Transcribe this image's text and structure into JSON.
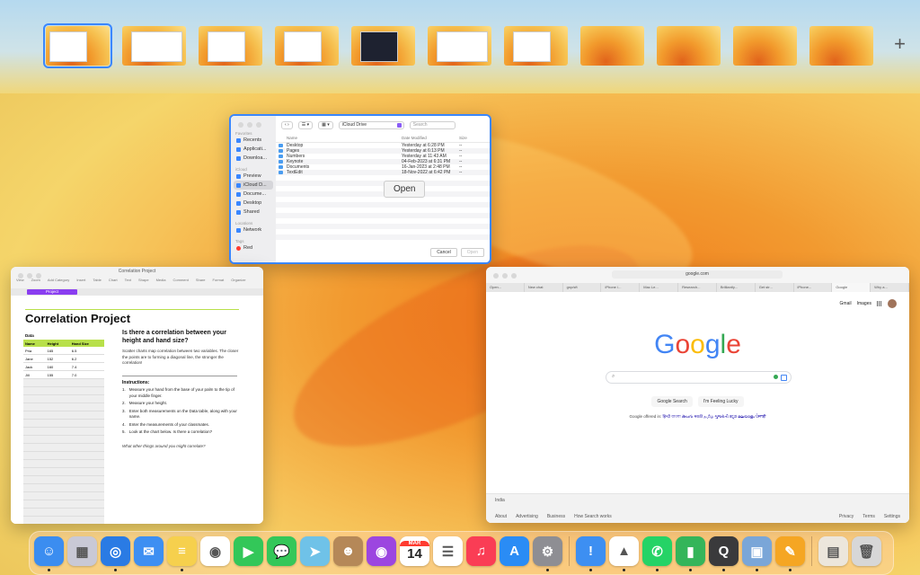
{
  "spaces": {
    "add_label": "+",
    "count": 11
  },
  "finder": {
    "sidebar": {
      "favorites_label": "Favorites",
      "favorites": [
        "Recents",
        "Applicati...",
        "Downloa..."
      ],
      "icloud_label": "iCloud",
      "icloud": [
        "Preview",
        "iCloud D...",
        "Docume...",
        "Desktop",
        "Shared"
      ],
      "locations_label": "Locations",
      "locations": [
        "Network"
      ],
      "tags_label": "Tags",
      "tags": [
        "Red"
      ]
    },
    "location": "iCloud Drive",
    "search_placeholder": "Search",
    "columns": {
      "name": "Name",
      "date": "Date Modified",
      "size": "Size"
    },
    "rows": [
      {
        "name": "Desktop",
        "date": "Yesterday at 6:28 PM",
        "size": "--"
      },
      {
        "name": "Pages",
        "date": "Yesterday at 6:13 PM",
        "size": "--"
      },
      {
        "name": "Numbers",
        "date": "Yesterday at 11:43 AM",
        "size": "--"
      },
      {
        "name": "Keynote",
        "date": "04-Feb-2023 at 6:31 PM",
        "size": "--"
      },
      {
        "name": "Documents",
        "date": "16-Jan-2023 at 2:48 PM",
        "size": "--"
      },
      {
        "name": "TextEdit",
        "date": "18-Nov-2022 at 6:42 PM",
        "size": "--"
      }
    ],
    "open_overlay": "Open",
    "cancel": "Cancel",
    "open": "Open"
  },
  "numbers": {
    "window_title": "Correlation Project",
    "toolbar": [
      "View",
      "Zoom",
      "Add Category",
      "Insert",
      "Table",
      "Chart",
      "Text",
      "Shape",
      "Media",
      "Comment",
      "Share",
      "Format",
      "Organize"
    ],
    "zoom": "125%",
    "sheet_tab": "Project",
    "heading": "Correlation Project",
    "data_label": "Data",
    "table_headers": [
      "Name",
      "Height",
      "Hand Size"
    ],
    "table_rows": [
      [
        "Pria",
        "165",
        "6.5"
      ],
      [
        "Jane",
        "152",
        "6.2"
      ],
      [
        "Jack",
        "160",
        "7.4"
      ],
      [
        "Jill",
        "155",
        "7.0"
      ]
    ],
    "question": "Is there a correlation between your height and hand size?",
    "description": "Scatter charts map correlation between two variables. The closer the points are to forming a diagonal line, the stronger the correlation!",
    "instructions_label": "Instructions:",
    "instructions": [
      "Measure your hand from the base of your palm to the tip of your middle finger.",
      "Measure your height.",
      "Enter both measurements on the Data table, along with your name.",
      "Enter the measurements of your classmates.",
      "Look at the chart below. Is there a correlation?"
    ],
    "closing": "What other things around you might correlate?"
  },
  "safari": {
    "url": "google.com",
    "tabs": [
      "Open...",
      "New chat",
      "gnp/sft",
      "iPhone /...",
      "Mac Le...",
      "Research...",
      "Brilliantly...",
      "Get str...",
      "iPhone...",
      "Google",
      "Why a..."
    ],
    "gmail": "Gmail",
    "images": "Images",
    "logo": [
      "G",
      "o",
      "o",
      "g",
      "l",
      "e"
    ],
    "logo_colors": [
      "#4285f4",
      "#ea4335",
      "#fbbc05",
      "#4285f4",
      "#34a853",
      "#ea4335"
    ],
    "search_button": "Google Search",
    "lucky_button": "I'm Feeling Lucky",
    "offered_in": "Google offered in:",
    "languages": "हिन्दी বাংলা తెలుగు मराठी தமிழ் ગુજરાતી ಕನ್ನಡ മലയാളം ਪੰਜਾਬੀ",
    "country": "India",
    "footer_left": [
      "About",
      "Advertising",
      "Business",
      "How Search works"
    ],
    "footer_right": [
      "Privacy",
      "Terms",
      "Settings"
    ]
  },
  "dock": {
    "calendar_month": "MAR",
    "calendar_day": "14",
    "apps": [
      {
        "name": "finder",
        "color": "#3b8df0",
        "glyph": "☺",
        "running": true
      },
      {
        "name": "launchpad",
        "color": "#c9c9d6",
        "glyph": "▦",
        "running": false
      },
      {
        "name": "safari",
        "color": "#2a7be4",
        "glyph": "◎",
        "running": true
      },
      {
        "name": "mail",
        "color": "#3d8ff2",
        "glyph": "✉",
        "running": false
      },
      {
        "name": "notes",
        "color": "#f6d04d",
        "glyph": "≡",
        "running": true
      },
      {
        "name": "chrome",
        "color": "#ffffff",
        "glyph": "◉",
        "running": false
      },
      {
        "name": "facetime",
        "color": "#33c759",
        "glyph": "▶",
        "running": false
      },
      {
        "name": "messages",
        "color": "#34c759",
        "glyph": "💬",
        "running": false
      },
      {
        "name": "maps",
        "color": "#6fc2e8",
        "glyph": "➤",
        "running": false
      },
      {
        "name": "contacts",
        "color": "#b58858",
        "glyph": "☻",
        "running": false
      },
      {
        "name": "podcasts",
        "color": "#9c46e0",
        "glyph": "◉",
        "running": false
      },
      {
        "name": "calendar",
        "color": "#ffffff",
        "glyph": "",
        "running": false
      },
      {
        "name": "reminders",
        "color": "#ffffff",
        "glyph": "☰",
        "running": false
      },
      {
        "name": "music",
        "color": "#fa3d55",
        "glyph": "♫",
        "running": false
      },
      {
        "name": "app-store",
        "color": "#2a8cf5",
        "glyph": "A",
        "running": false
      },
      {
        "name": "system-settings",
        "color": "#8e8e93",
        "glyph": "⚙",
        "running": true
      },
      {
        "name": "feedback",
        "color": "#3d8ff2",
        "glyph": "!",
        "running": true
      },
      {
        "name": "clickup",
        "color": "#ffffff",
        "glyph": "▲",
        "running": true
      },
      {
        "name": "whatsapp",
        "color": "#25d366",
        "glyph": "✆",
        "running": true
      },
      {
        "name": "numbers",
        "color": "#34b55a",
        "glyph": "▮",
        "running": true
      },
      {
        "name": "quicktime",
        "color": "#3a3a3c",
        "glyph": "Q",
        "running": true
      },
      {
        "name": "preview",
        "color": "#7aa6d8",
        "glyph": "▣",
        "running": true
      },
      {
        "name": "pages",
        "color": "#f5a623",
        "glyph": "✎",
        "running": true
      },
      {
        "name": "downloads-stack",
        "color": "#ece6dc",
        "glyph": "▤",
        "running": false
      },
      {
        "name": "trash",
        "color": "#d7d7d7",
        "glyph": "🗑",
        "running": false
      }
    ]
  }
}
